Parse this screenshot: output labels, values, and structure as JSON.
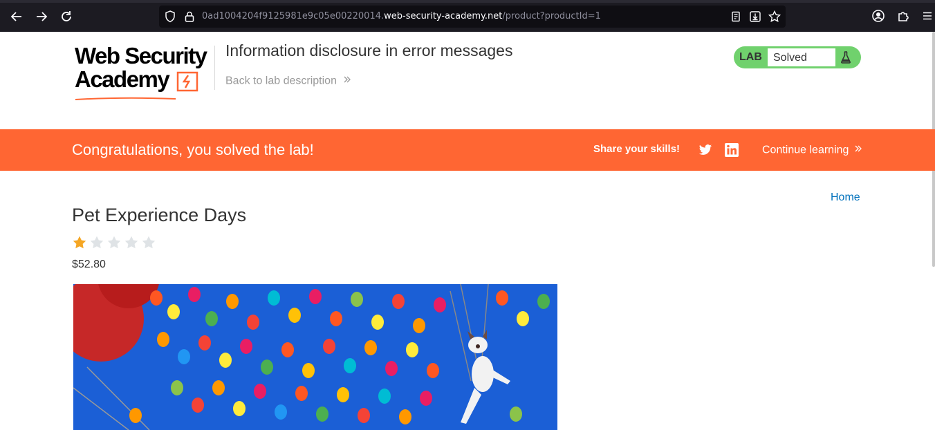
{
  "browser": {
    "url_prefix": "0ad1004204f9125981e9c05e00220014.",
    "url_host": "web-security-academy.net",
    "url_path": "/product?productId=1",
    "icons": [
      "back-icon",
      "forward-icon",
      "reload-icon",
      "shield-icon",
      "lock-icon",
      "reader-view-icon",
      "download-icon",
      "bookmark-star-icon",
      "account-icon",
      "extensions-icon",
      "menu-icon"
    ]
  },
  "header": {
    "logo_line1": "Web Security",
    "logo_line2": "Academy",
    "lab_title": "Information disclosure in error messages",
    "back_link": "Back to lab description",
    "lab_badge": {
      "label": "LAB",
      "status": "Solved",
      "icon": "flask-icon"
    }
  },
  "banner": {
    "message": "Congratulations, you solved the lab!",
    "share_label": "Share your skills!",
    "continue_label": "Continue learning",
    "social_icons": [
      "twitter-icon",
      "linkedin-icon"
    ]
  },
  "nav": {
    "home_label": "Home"
  },
  "product": {
    "title": "Pet Experience Days",
    "rating": 1,
    "rating_max": 5,
    "price": "$52.80",
    "colors": {
      "star_filled": "#f5a623",
      "star_empty": "#dfe3e6"
    }
  },
  "colors": {
    "accent": "#ff6633",
    "lab_green": "#70d16d",
    "link": "#0071bc"
  }
}
